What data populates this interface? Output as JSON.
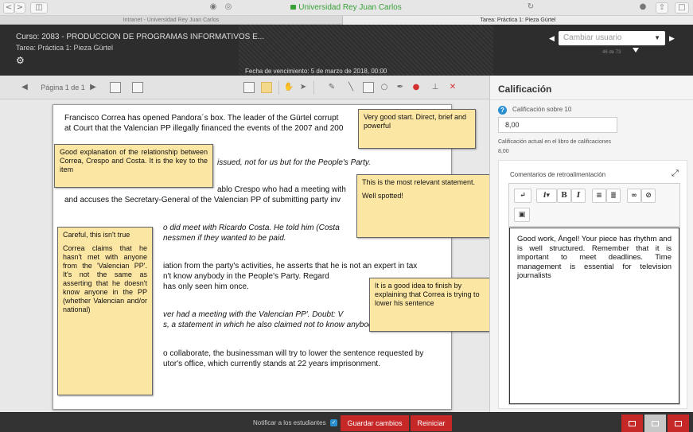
{
  "browser": {
    "back": "<",
    "forward": ">",
    "url": "Universidad Rey Juan Carlos",
    "tabs": [
      "Intranet - Universidad Rey Juan Carlos",
      "Tarea: Práctica 1: Pieza Gürtel"
    ]
  },
  "header": {
    "course": "Curso: 2083 - PRODUCCION DE PROGRAMAS INFORMATIVOS E...",
    "assignment": "Tarea: Práctica 1: Pieza Gürtel",
    "due_date": "Fecha de vencimiento: 5 de marzo de 2018, 00:00",
    "user_select_placeholder": "Cambiar usuario",
    "user_count": "46 de 73"
  },
  "toolbar": {
    "page_label": "Página 1 de 1"
  },
  "document": {
    "paragraphs": [
      "Francisco Correa has opened Pandora´s box. The leader of the Gürtel corrupt",
      "at Court that the Valencian PP illegally financed the events of the 2007 and 200",
      "issued, not for us but for the People's Party.",
      "ablo Crespo who had a meeting with",
      "and accuses the Secretary-General of the Valencian PP of submitting party inv",
      "o did meet with Ricardo Costa. He told him (Costa",
      "nessmen if they wanted to be paid.",
      "iation from the party's activities, he asserts that he is not an expert in tax",
      "n't know anybody in the People's Party. Regard",
      "has only seen him once.",
      "ver had a meeting with the Valencian PP'. Doubt: V",
      "s, a statement in which he also claimed not to know anybody in the party.",
      "o collaborate, the businessman will try to lower the sentence requested by",
      "utor's office, which currently stands at 22 years imprisonment."
    ]
  },
  "annotations": {
    "note1": "Very good start. Direct, brief and powerful",
    "note2": "Good explanation of the relationship between Correa, Crespo and Costa. It is the key to the item",
    "note3_a": "This is the most relevant statement.",
    "note3_b": "Well spotted!",
    "note4_a": "Careful, this isn't true",
    "note4_b": "Correa claims that he hasn't met with anyone from the 'Valencian PP'. It's not the same as asserting that he doesn't know anyone in the PP (whether Valencian and/or national)",
    "note5": "It is a good idea to finish by explaining that Correa is trying to lower his sentence"
  },
  "grading": {
    "title": "Calificación",
    "grade_label": "Calificación sobre 10",
    "grade_value": "8,00",
    "gradebook_label": "Calificación actual en el libro de calificaciones",
    "gradebook_value": "8,00",
    "feedback_title": "Comentarios de retroalimentación",
    "feedback_text": "Good work, Ángel! Your piece has rhythm and is well structured. Remember that it is important to meet deadlines. Time management is essential for television journalists"
  },
  "footer": {
    "notify_label": "Notificar a los estudiantes",
    "save_label": "Guardar cambios",
    "reset_label": "Reiniciar"
  },
  "colors": {
    "accent_red": "#c62828",
    "note_yellow": "#fce6a4",
    "url_green": "#3aa038"
  }
}
